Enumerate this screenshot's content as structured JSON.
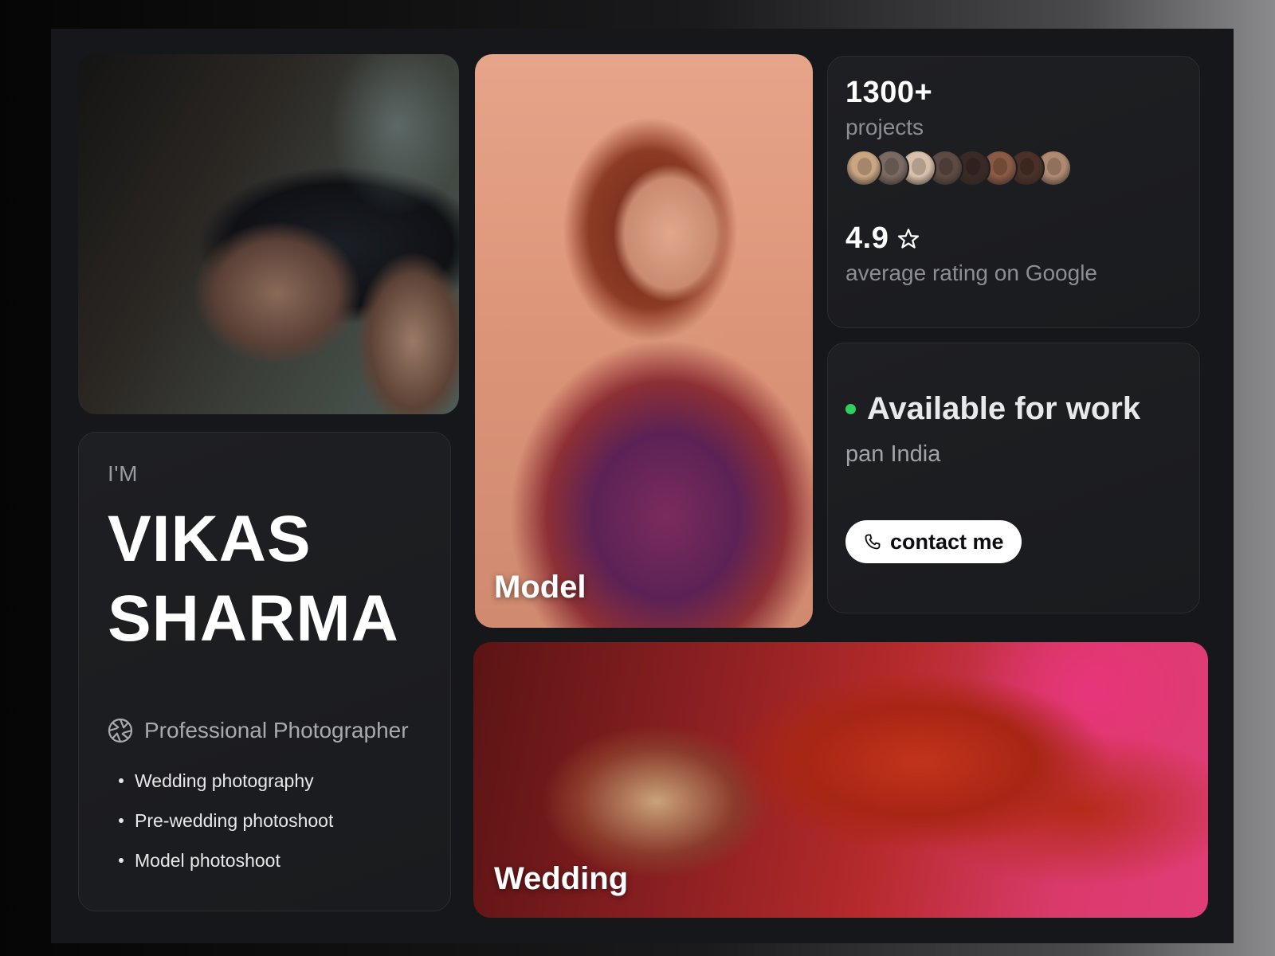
{
  "intro": {
    "prefix": "I'M",
    "first_name": "VIKAS",
    "last_name": "SHARMA",
    "role": "Professional Photographer",
    "services": [
      "Wedding photography",
      "Pre-wedding photoshoot",
      "Model photoshoot"
    ]
  },
  "gallery": {
    "model_label": "Model",
    "wedding_label": "Wedding"
  },
  "stats": {
    "projects_value": "1300+",
    "projects_label": "projects",
    "rating_value": "4.9",
    "rating_label": "average rating on Google",
    "avatar_colors": [
      "#c9a582",
      "#7a6a62",
      "#d8c0aa",
      "#5d4a44",
      "#3a2a25",
      "#8a5a44",
      "#4a3028",
      "#b08a70"
    ]
  },
  "availability": {
    "title": "Available for work",
    "region": "pan India",
    "contact_label": "contact me",
    "status_color": "#2fd15a"
  },
  "icons": {
    "role_icon": "aperture-icon",
    "rating_icon": "star-icon",
    "contact_icon": "phone-icon"
  }
}
